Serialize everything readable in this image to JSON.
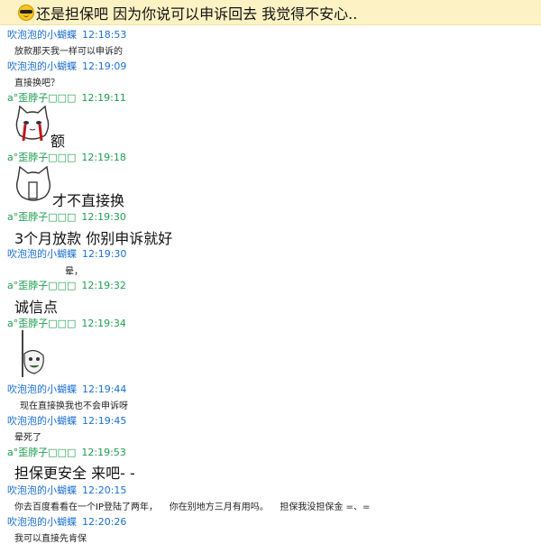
{
  "banner": {
    "text": "还是担保吧 因为你说可以申诉回去 我觉得不安心.."
  },
  "messages": [
    {
      "sender": "吹泡泡的小蝴蝶",
      "time": "12:18:53",
      "text": "放款那天我一样可以申诉的"
    },
    {
      "sender": "吹泡泡的小蝴蝶",
      "time": "12:19:09",
      "text": "直接换吧？"
    },
    {
      "sender": "a°歪脖子□□□",
      "time": "12:19:11",
      "text": "额"
    },
    {
      "sender": "a°歪脖子□□□",
      "time": "12:19:18",
      "text": "才不直接换"
    },
    {
      "sender": "a°歪脖子□□□",
      "time": "12:19:30",
      "text": "3个月放款 你别申诉就好"
    },
    {
      "sender": "吹泡泡的小蝴蝶",
      "time": "12:19:30",
      "text": "晕，"
    },
    {
      "sender": "a°歪脖子□□□",
      "time": "12:19:32",
      "text": "诚信点"
    },
    {
      "sender": "a°歪脖子□□□",
      "time": "12:19:34",
      "text": ""
    },
    {
      "sender": "吹泡泡的小蝴蝶",
      "time": "12:19:44",
      "text": "现在直接换我也不会申诉呀"
    },
    {
      "sender": "吹泡泡的小蝴蝶",
      "time": "12:19:45",
      "text": "晕死了"
    },
    {
      "sender": "a°歪脖子□□□",
      "time": "12:19:53",
      "text": "担保更安全 来吧- -"
    },
    {
      "sender": "吹泡泡的小蝴蝶",
      "time": "12:20:15",
      "text": "你去百度看看在一个IP登陆了两年，    你在别地方三月有用吗。    担保我没担保金 =、="
    },
    {
      "sender": "吹泡泡的小蝴蝶",
      "time": "12:20:26",
      "text": "我可以直接先肯保"
    }
  ],
  "colors": {
    "sender_a": "#1a6fd1",
    "sender_b": "#1e9d4e",
    "banner_bg": "#fdf2c4"
  },
  "icons": [
    "sunglasses-emoji-icon",
    "crying-cat-sticker",
    "shy-cat-sticker",
    "peeking-face-sticker"
  ]
}
